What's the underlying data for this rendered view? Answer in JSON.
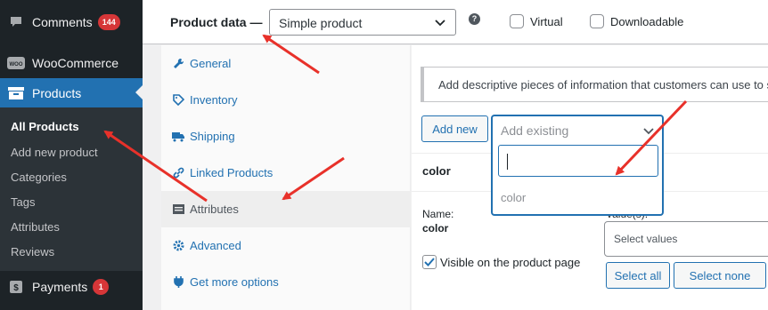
{
  "sidebar": {
    "comments": {
      "label": "Comments",
      "badge": "144"
    },
    "woocommerce": {
      "label": "WooCommerce",
      "logo_text": "WOO"
    },
    "products": {
      "label": "Products"
    },
    "submenu": [
      "All Products",
      "Add new product",
      "Categories",
      "Tags",
      "Attributes",
      "Reviews"
    ],
    "payments": {
      "label": "Payments",
      "badge": "1"
    }
  },
  "product_data": {
    "title": "Product data —",
    "type_value": "Simple product",
    "help": "?",
    "virtual_label": "Virtual",
    "downloadable_label": "Downloadable"
  },
  "tabs": [
    {
      "label": "General",
      "icon": "wrench-icon"
    },
    {
      "label": "Inventory",
      "icon": "tag-icon"
    },
    {
      "label": "Shipping",
      "icon": "truck-icon"
    },
    {
      "label": "Linked Products",
      "icon": "link-icon"
    },
    {
      "label": "Attributes",
      "icon": "list-icon"
    },
    {
      "label": "Advanced",
      "icon": "gear-icon"
    },
    {
      "label": "Get more options",
      "icon": "plugin-icon"
    }
  ],
  "active_tab": "Attributes",
  "attributes_panel": {
    "notice": "Add descriptive pieces of information that customers can use to s",
    "add_new_label": "Add new",
    "add_existing_placeholder": "Add existing",
    "search_value": "",
    "option": "color",
    "attribute_heading": "color",
    "name_label": "Name:",
    "name_value": "color",
    "values_label": "Value(s):",
    "visible_label": "Visible on the product page",
    "visible_checked": true,
    "select_values_placeholder": "Select values",
    "select_all_label": "Select all",
    "select_none_label": "Select none"
  },
  "colors": {
    "sidebar_bg": "#1d2327",
    "active_menu": "#2271b1",
    "badge": "#d63638",
    "link": "#2271b1",
    "annotation_arrow": "#e8312a"
  }
}
